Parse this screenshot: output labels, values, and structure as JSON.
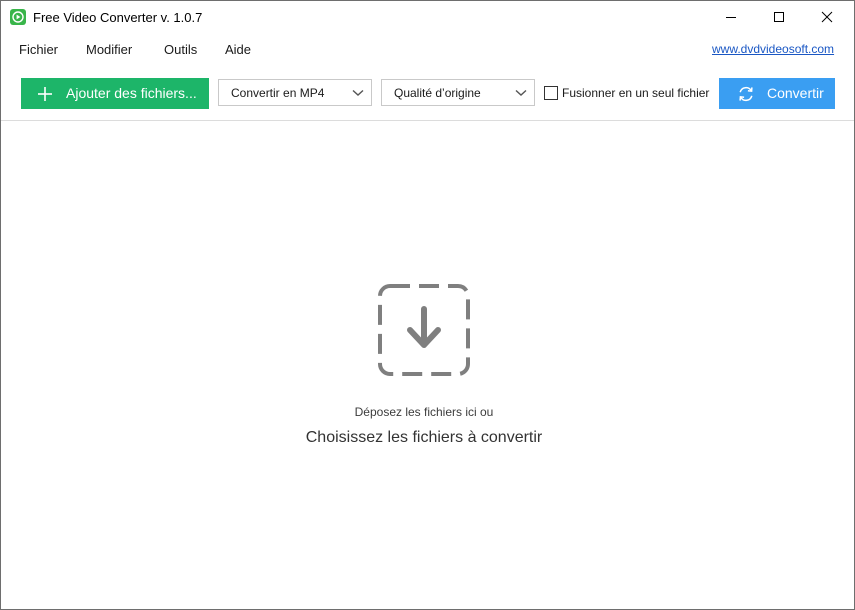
{
  "window": {
    "title": "Free Video Converter v. 1.0.7"
  },
  "menu": {
    "items": [
      "Fichier",
      "Modifier",
      "Outils",
      "Aide"
    ],
    "site_link": "www.dvdvideosoft.com"
  },
  "toolbar": {
    "add_files_label": "Ajouter des fichiers...",
    "format_select_value": "Convertir en MP4",
    "quality_select_value": "Qualité d’origine",
    "merge_label": "Fusionner en un seul fichier",
    "merge_checked": false,
    "convert_label": "Convertir"
  },
  "dropzone": {
    "hint": "Déposez les fichiers ici ou",
    "choose_label": "Choisissez les fichiers à convertir"
  },
  "colors": {
    "add_button": "#1db569",
    "convert_button": "#3a9ef2",
    "app_icon": "#39b54a",
    "link": "#1a57c4"
  },
  "icons": {
    "app": "app-logo-icon",
    "minimize": "minimize-icon",
    "maximize": "maximize-icon",
    "close": "close-icon",
    "add": "plus-icon",
    "dropdown": "chevron-down-icon",
    "convert": "refresh-icon",
    "drop": "download-arrow-icon"
  }
}
